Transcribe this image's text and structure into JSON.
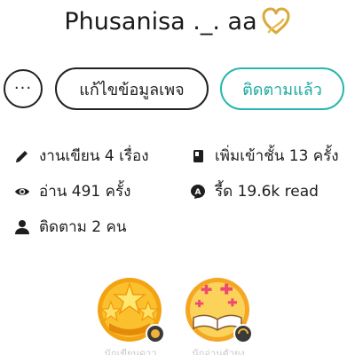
{
  "profile": {
    "name": "Phusanisa ._. aa",
    "heart_color": "#d9a93a"
  },
  "actions": {
    "more_label": "···",
    "edit_label": "แก้ไขข้อมูลเพจ",
    "follow_label": "ติดตามแล้ว",
    "accent_color": "#27b7ae"
  },
  "stats": {
    "works": {
      "label": "งานเขียน 4 เรื่อง",
      "icon": "pencil-icon"
    },
    "library": {
      "label": "เพิ่มเข้าชั้น 13 ครั้ง",
      "icon": "book-icon"
    },
    "reads": {
      "label": "อ่าน 491 ครั้ง",
      "icon": "eye-icon"
    },
    "votes": {
      "label": "รี้ด 19.6k read",
      "icon": "read-badge-icon"
    },
    "followers": {
      "label": "ติดตาม 2 คน",
      "icon": "person-icon"
    }
  },
  "badges": [
    {
      "name": "writer-badge",
      "label": "นักเขียนดาว",
      "icon": "stars-icon"
    },
    {
      "name": "reader-badge",
      "label": "นักอ่านตัวยง",
      "icon": "open-book-icon"
    }
  ]
}
